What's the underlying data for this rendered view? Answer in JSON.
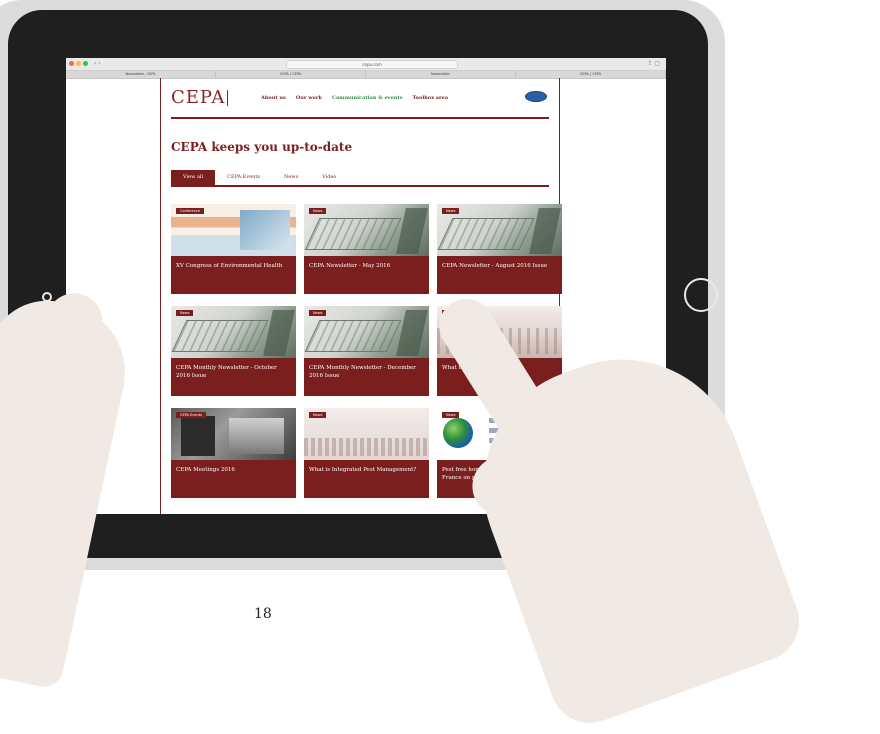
{
  "browser": {
    "url": "cepa.com",
    "tabs": [
      "Newsletter, CEPA",
      "CEPA | CEPA",
      "Newsletter",
      "CEPA | CEPA"
    ]
  },
  "site": {
    "logo": "CEPA",
    "menu": [
      "About us",
      "Our work",
      "Communication & events",
      "Toolbox area"
    ],
    "menu_active_index": 2
  },
  "page": {
    "title": "CEPA keeps you up-to-date",
    "filter_tabs": [
      "View all",
      "CEPA Events",
      "News",
      "Video"
    ]
  },
  "cards": [
    {
      "tag": "Conference",
      "title": "XV Congress of Environmental Health",
      "image": "poster"
    },
    {
      "tag": "News",
      "title": "CEPA Newsletter - May 2016",
      "image": "glass"
    },
    {
      "tag": "News",
      "title": "CEPA Newsletter - August 2016 Issue",
      "image": "glass"
    },
    {
      "tag": "News",
      "title": "CEPA Monthly Newsletter - October 2016 Issue",
      "image": "glass"
    },
    {
      "tag": "News",
      "title": "CEPA Monthly Newsletter - December 2016 Issue",
      "image": "glass"
    },
    {
      "tag": "News",
      "title": "What is a pest...",
      "image": "mist"
    },
    {
      "tag": "CEPA Events",
      "title": "CEPA Meetings 2016",
      "image": "bw"
    },
    {
      "tag": "News",
      "title": "What is Integrated Pest Management?",
      "image": "city"
    },
    {
      "tag": "News",
      "title": "Pest free homes: New legislation in France on pest...",
      "image": "globe"
    }
  ],
  "footer": {
    "page_number": "18"
  },
  "colors": {
    "brand": "#7b1e1e",
    "active_menu": "#2f8f46",
    "device_frame": "#1f1f1f"
  }
}
